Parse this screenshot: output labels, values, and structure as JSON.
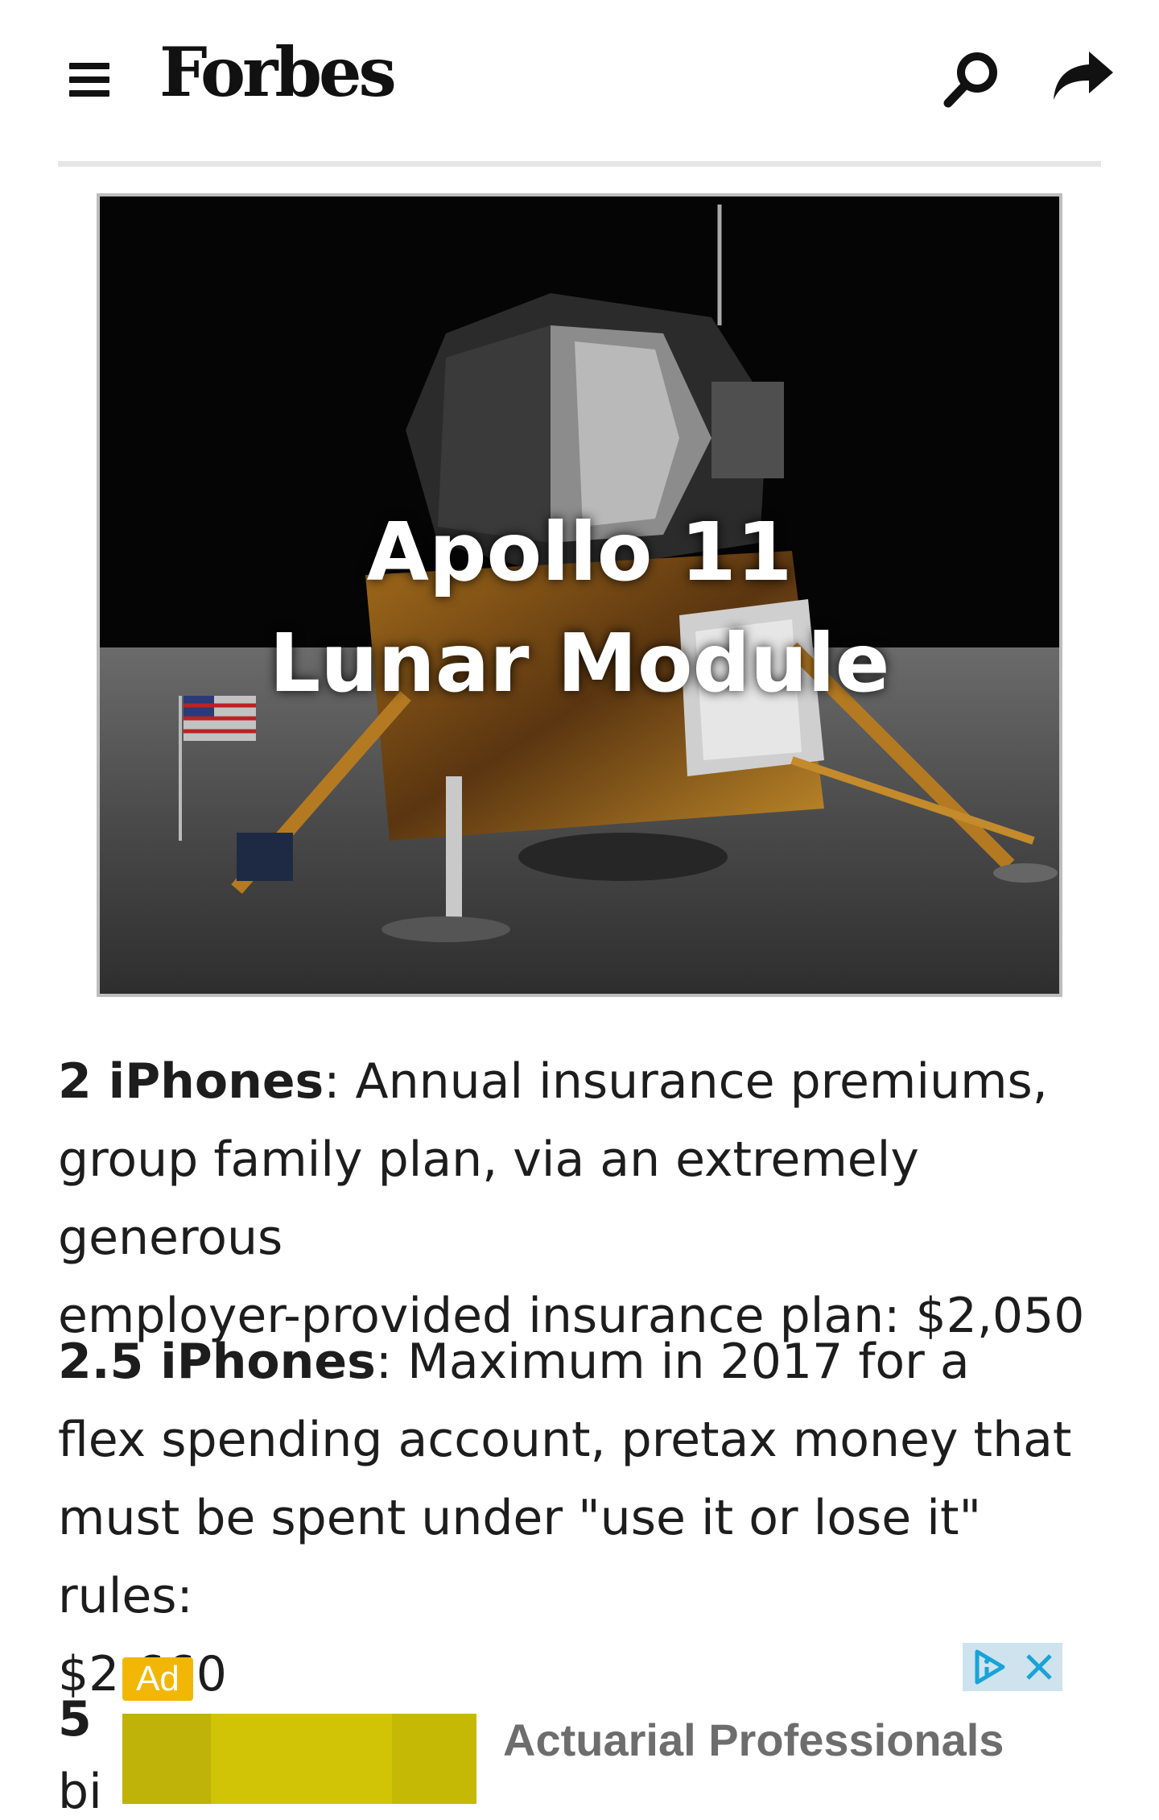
{
  "header": {
    "logo": "Forbes",
    "menu_icon": "hamburger-menu-icon",
    "search_icon": "search-icon",
    "share_icon": "share-arrow-icon"
  },
  "hero": {
    "title_line1": "Apollo 11",
    "title_line2": "Lunar Module"
  },
  "paragraphs": [
    {
      "bold": "2 iPhones",
      "text_lines": [
        ": Annual insurance premiums,",
        "group family plan, via an extremely generous",
        "employer-provided insurance plan: $2,050"
      ]
    },
    {
      "bold": "2.5 iPhones",
      "text_lines": [
        ": Maximum in 2017 for a",
        "flex spending account, pretax money that",
        "must be spent under \"use it or lose it\" rules:",
        "$2,660"
      ]
    }
  ],
  "ad": {
    "badge": "Ad",
    "fragment_number": "5",
    "fragment_text": "bi",
    "headline": "Actuarial Professionals",
    "adchoices_icon": "adchoices-icon",
    "close_icon": "close-icon",
    "accent": "#f2b705"
  }
}
